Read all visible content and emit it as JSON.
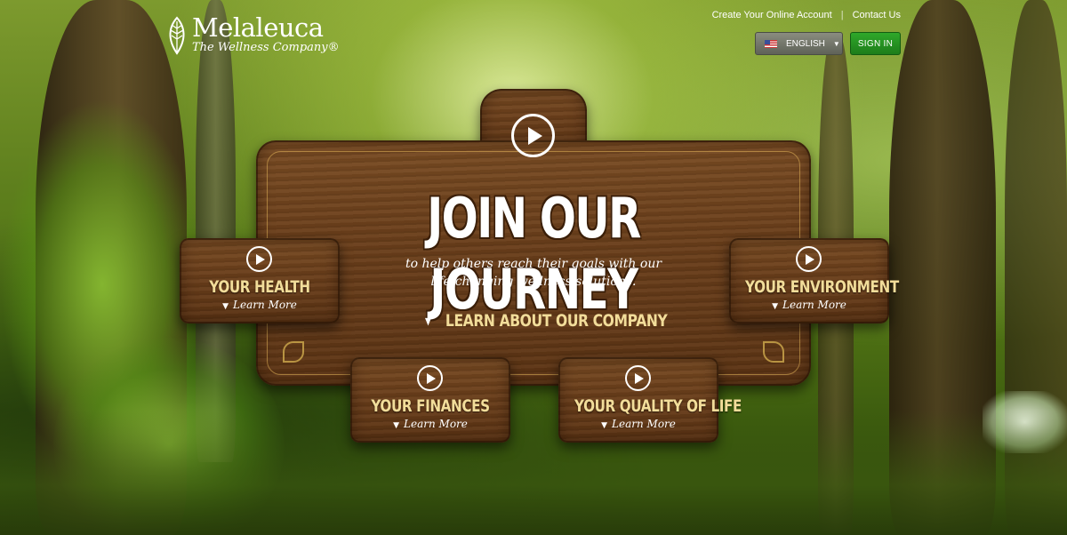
{
  "brand": {
    "name": "Melaleuca",
    "tagline": "The Wellness Company®",
    "accent": "#1d7d1a",
    "wood": "#6b3f1b"
  },
  "header": {
    "links": [
      "Create Your Online Account",
      "Contact Us"
    ],
    "language": {
      "flag": "us-flag-icon",
      "label": "ENGLISH"
    },
    "signin_label": "SIGN IN"
  },
  "hero": {
    "headline": "JOIN OUR JOURNEY",
    "subtext_line1": "to help others reach their goals with our",
    "subtext_line2": "life-changing wellness solutions.",
    "cta": "LEARN ABOUT OUR COMPANY"
  },
  "panels": [
    {
      "title": "YOUR HEALTH",
      "link": "Learn More"
    },
    {
      "title": "YOUR ENVIRONMENT",
      "link": "Learn More"
    },
    {
      "title": "YOUR FINANCES",
      "link": "Learn More"
    },
    {
      "title": "YOUR QUALITY OF LIFE",
      "link": "Learn More"
    }
  ]
}
